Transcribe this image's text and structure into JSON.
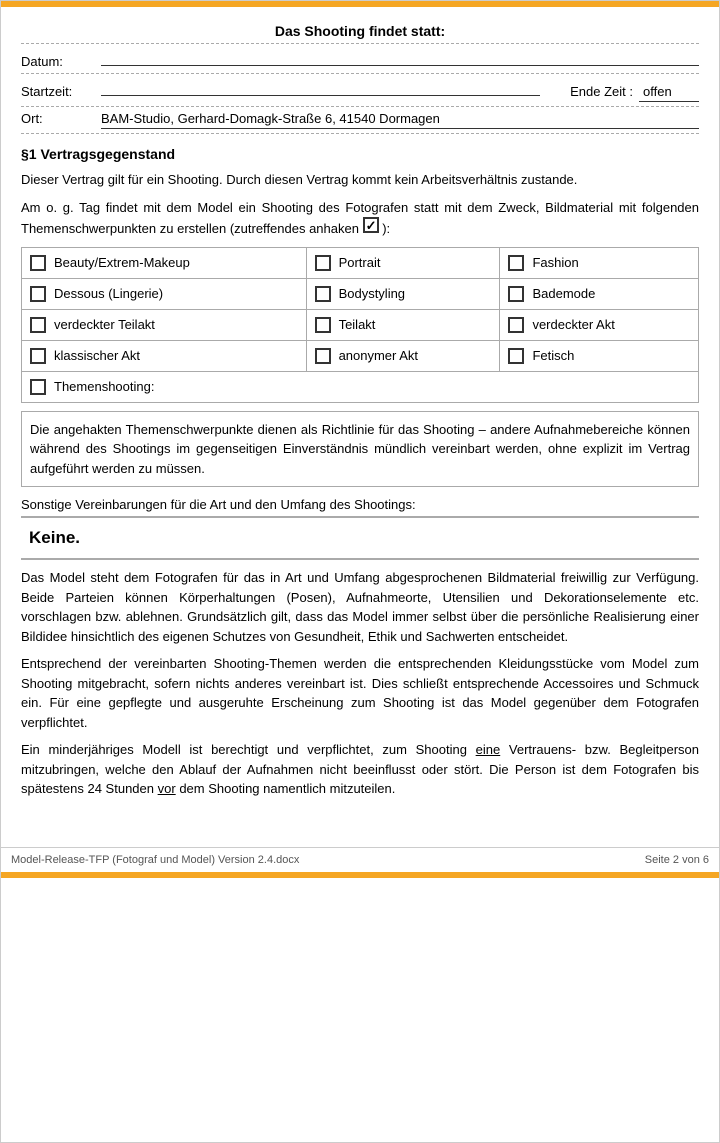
{
  "header": {
    "title": "Das Shooting findet statt:"
  },
  "fields": {
    "datum_label": "Datum:",
    "datum_value": "",
    "startzeit_label": "Startzeit:",
    "startzeit_value": "",
    "endzeit_label": "Ende Zeit :",
    "endzeit_value": "offen",
    "ort_label": "Ort:",
    "ort_value": "BAM-Studio, Gerhard-Domagk-Straße 6, 41540 Dormagen"
  },
  "section1": {
    "title": "§1 Vertragsgegenstand",
    "para1": "Dieser Vertrag gilt für ein Shooting. Durch diesen Vertrag kommt kein Arbeitsverhältnis zustande.",
    "para2_start": "Am o. g. Tag findet mit dem Model ein Shooting des Fotografen statt mit dem Zweck, Bildmaterial mit folgenden Themenschwerpunkten zu erstellen (zutreffendes anhaken",
    "para2_end": "):"
  },
  "checkboxes": {
    "rows": [
      [
        {
          "label": "Beauty/Extrem-Makeup",
          "checked": false
        },
        {
          "label": "Portrait",
          "checked": false
        },
        {
          "label": "Fashion",
          "checked": false
        }
      ],
      [
        {
          "label": "Dessous (Lingerie)",
          "checked": false
        },
        {
          "label": "Bodystyling",
          "checked": false
        },
        {
          "label": "Bademode",
          "checked": false
        }
      ],
      [
        {
          "label": "verdeckter Teilakt",
          "checked": false
        },
        {
          "label": "Teilakt",
          "checked": false
        },
        {
          "label": "verdeckter Akt",
          "checked": false
        }
      ],
      [
        {
          "label": "klassischer Akt",
          "checked": false
        },
        {
          "label": "anonymer Akt",
          "checked": false
        },
        {
          "label": "Fetisch",
          "checked": false
        }
      ]
    ],
    "themenshooting_label": "Themenshooting:"
  },
  "note": "Die angehakten Themenschwerpunkte dienen als Richtlinie für das Shooting – andere Aufnahmebereiche können während des Shootings im gegenseitigen Einverständnis mündlich vereinbart werden, ohne explizit im Vertrag aufgeführt werden zu müssen.",
  "sonstige": {
    "label": "Sonstige Vereinbarungen für die Art und den Umfang des Shootings:",
    "keine": "Keine."
  },
  "paragraphs": {
    "p1": "Das Model steht dem Fotografen für das in Art und Umfang abgesprochenen Bildmaterial freiwillig zur Verfügung. Beide Parteien können Körperhaltungen (Posen), Aufnahmeorte, Utensilien und Dekorationselemente etc. vorschlagen bzw. ablehnen. Grundsätzlich gilt, dass das Model immer selbst über die persönliche Realisierung einer Bildidee hinsichtlich des eigenen Schutzes von Gesundheit, Ethik und Sachwerten entscheidet.",
    "p2": "Entsprechend der vereinbarten Shooting-Themen werden die entsprechenden Kleidungsstücke vom Model zum Shooting mitgebracht, sofern nichts anderes vereinbart ist. Dies schließt entsprechende Accessoires und Schmuck ein. Für eine gepflegte und ausgeruhte Erscheinung zum Shooting ist das Model gegenüber dem Fotografen verpflichtet.",
    "p3_start": "Ein minderjähriges Modell ist berechtigt und verpflichtet, zum Shooting",
    "p3_underline": "eine",
    "p3_mid": "Vertrauens- bzw. Begleitperson mitzubringen, welche den Ablauf der Aufnahmen nicht beeinflusst oder stört. Die Person ist dem Fotografen bis spätestens 24 Stunden",
    "p3_underline2": "vor",
    "p3_end": "dem Shooting namentlich mitzuteilen."
  },
  "footer": {
    "left": "Model-Release-TFP (Fotograf und Model) Version 2.4.docx",
    "right": "Seite 2 von 6"
  }
}
